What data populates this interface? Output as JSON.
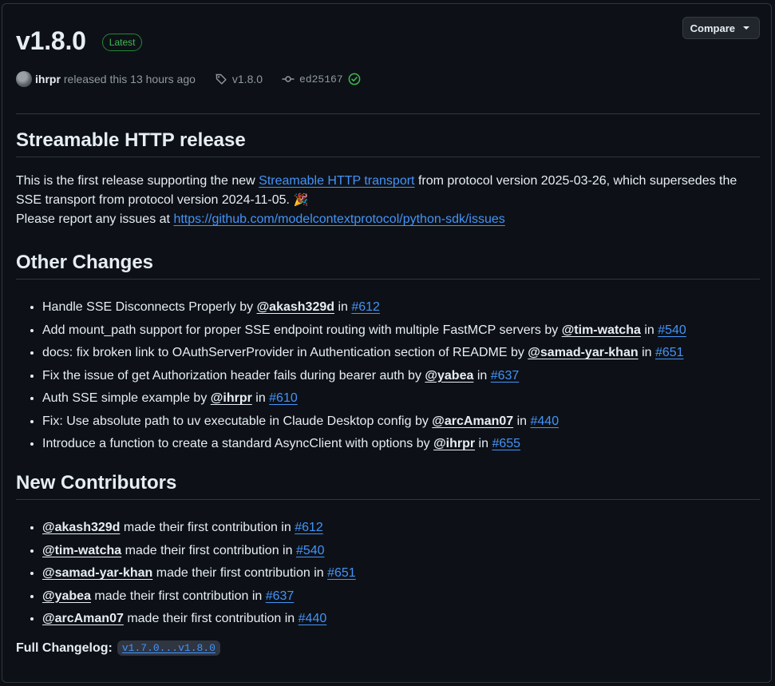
{
  "release": {
    "version": "v1.8.0",
    "badge": "Latest",
    "compare_label": "Compare",
    "author": "ihrpr",
    "released_text": "released this 13 hours ago",
    "tag": "v1.8.0",
    "commit": "ed25167"
  },
  "section1": {
    "heading": "Streamable HTTP release",
    "intro_1": "This is the first release supporting the new ",
    "intro_link": "Streamable HTTP transport",
    "intro_2": " from protocol version 2025-03-26, which supersedes the SSE transport from protocol version 2024-11-05. ",
    "intro_emoji": "🎉",
    "report_text": "Please report any issues at ",
    "report_link": "https://github.com/modelcontextprotocol/python-sdk/issues"
  },
  "other_changes": {
    "heading": "Other Changes",
    "items": [
      {
        "text": "Handle SSE Disconnects Properly by ",
        "user": "@akash329d",
        "in": " in ",
        "pr": "#612"
      },
      {
        "text": "Add mount_path support for proper SSE endpoint routing with multiple FastMCP servers by ",
        "user": "@tim-watcha",
        "in": " in ",
        "pr": "#540"
      },
      {
        "text": "docs: fix broken link to OAuthServerProvider in Authentication section of README by ",
        "user": "@samad-yar-khan",
        "in": " in ",
        "pr": "#651"
      },
      {
        "text": "Fix the issue of get Authorization header fails during bearer auth by ",
        "user": "@yabea",
        "in": " in ",
        "pr": "#637"
      },
      {
        "text": "Auth SSE simple example by ",
        "user": "@ihrpr",
        "in": " in ",
        "pr": "#610"
      },
      {
        "text": "Fix: Use absolute path to uv executable in Claude Desktop config by ",
        "user": "@arcAman07",
        "in": " in ",
        "pr": "#440"
      },
      {
        "text": "Introduce a function to create a standard AsyncClient with options by ",
        "user": "@ihrpr",
        "in": " in ",
        "pr": "#655"
      }
    ]
  },
  "new_contributors": {
    "heading": "New Contributors",
    "items": [
      {
        "user": "@akash329d",
        "text": " made their first contribution in ",
        "pr": "#612"
      },
      {
        "user": "@tim-watcha",
        "text": " made their first contribution in ",
        "pr": "#540"
      },
      {
        "user": "@samad-yar-khan",
        "text": " made their first contribution in ",
        "pr": "#651"
      },
      {
        "user": "@yabea",
        "text": " made their first contribution in ",
        "pr": "#637"
      },
      {
        "user": "@arcAman07",
        "text": " made their first contribution in ",
        "pr": "#440"
      }
    ]
  },
  "changelog": {
    "label": "Full Changelog",
    "colon": ":",
    "range": "v1.7.0...v1.8.0"
  },
  "colors": {
    "background": "#0d1117",
    "link": "#4493f8",
    "badge_green": "#3fb950",
    "muted": "#9198a1"
  }
}
